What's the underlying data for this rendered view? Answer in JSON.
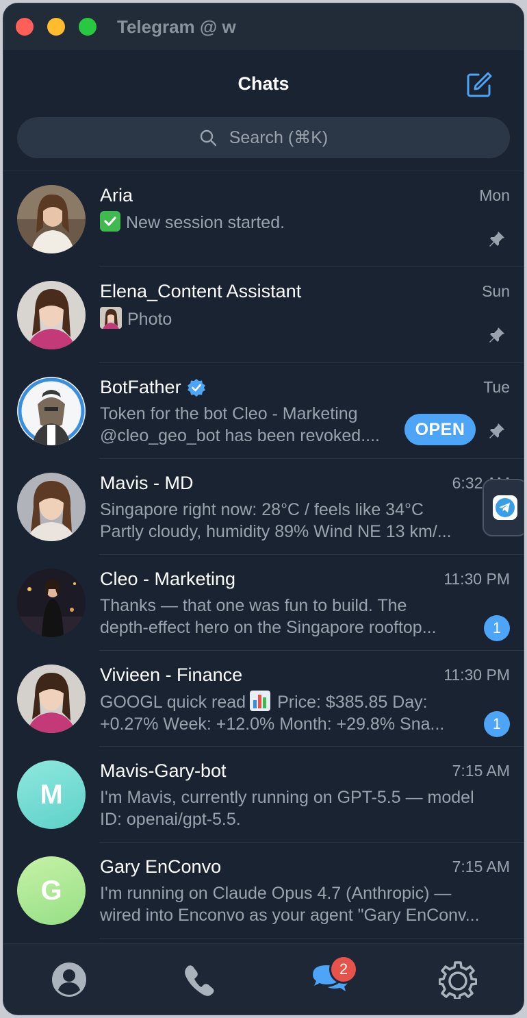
{
  "window": {
    "title": "Telegram @ w"
  },
  "header": {
    "title": "Chats",
    "compose_icon": "compose-icon"
  },
  "search": {
    "placeholder": "Search (⌘K)"
  },
  "chats": [
    {
      "name": "Aria",
      "time": "Mon",
      "message_lines": [
        "New session started."
      ],
      "pinned": true,
      "avatar": "photo"
    },
    {
      "name": "Elena_Content Assistant",
      "time": "Sun",
      "message_lines": [
        "Photo"
      ],
      "pinned": true,
      "avatar": "photo"
    },
    {
      "name": "BotFather",
      "time": "Tue",
      "verified": true,
      "message_lines": [
        "Token for the bot Cleo - Marketing",
        "@cleo_geo_bot has been revoked...."
      ],
      "pinned": true,
      "action_label": "OPEN",
      "avatar": "photo"
    },
    {
      "name": "Mavis - MD",
      "time": "6:32 AM",
      "message_lines": [
        "Singapore right now: 28°C / feels like 34°C",
        "Partly cloudy, humidity 89% Wind NE 13 km/..."
      ],
      "pinned": true,
      "avatar": "photo"
    },
    {
      "name": "Cleo - Marketing",
      "time": "11:30 PM",
      "message_lines": [
        "Thanks — that one was fun to build. The",
        "depth-effect hero on the Singapore rooftop..."
      ],
      "unread": "1",
      "avatar": "photo"
    },
    {
      "name": "Vivieen - Finance",
      "time": "11:30 PM",
      "message_lines": [
        "GOOGL quick read",
        "Price: $385.85 Day:",
        "+0.27% Week: +12.0% Month: +29.8%  Sna..."
      ],
      "unread": "1",
      "avatar": "photo"
    },
    {
      "name": "Mavis-Gary-bot",
      "time": "7:15 AM",
      "message_lines": [
        "I'm Mavis, currently running on GPT-5.5 — model",
        "ID: openai/gpt-5.5."
      ],
      "avatar_letter": "M"
    },
    {
      "name": "Gary EnConvo",
      "time": "7:15 AM",
      "message_lines": [
        "I'm running on Claude Opus 4.7 (Anthropic) —",
        "wired into Enconvo as your agent \"Gary EnConv..."
      ],
      "avatar_letter": "G"
    }
  ],
  "tabbar": {
    "items": [
      "contacts-icon",
      "calls-icon",
      "chats-icon",
      "settings-icon"
    ],
    "chats_badge": "2"
  },
  "colors": {
    "accent": "#4ea4f6",
    "background": "#1a2331",
    "badge_red": "#e5534b"
  }
}
